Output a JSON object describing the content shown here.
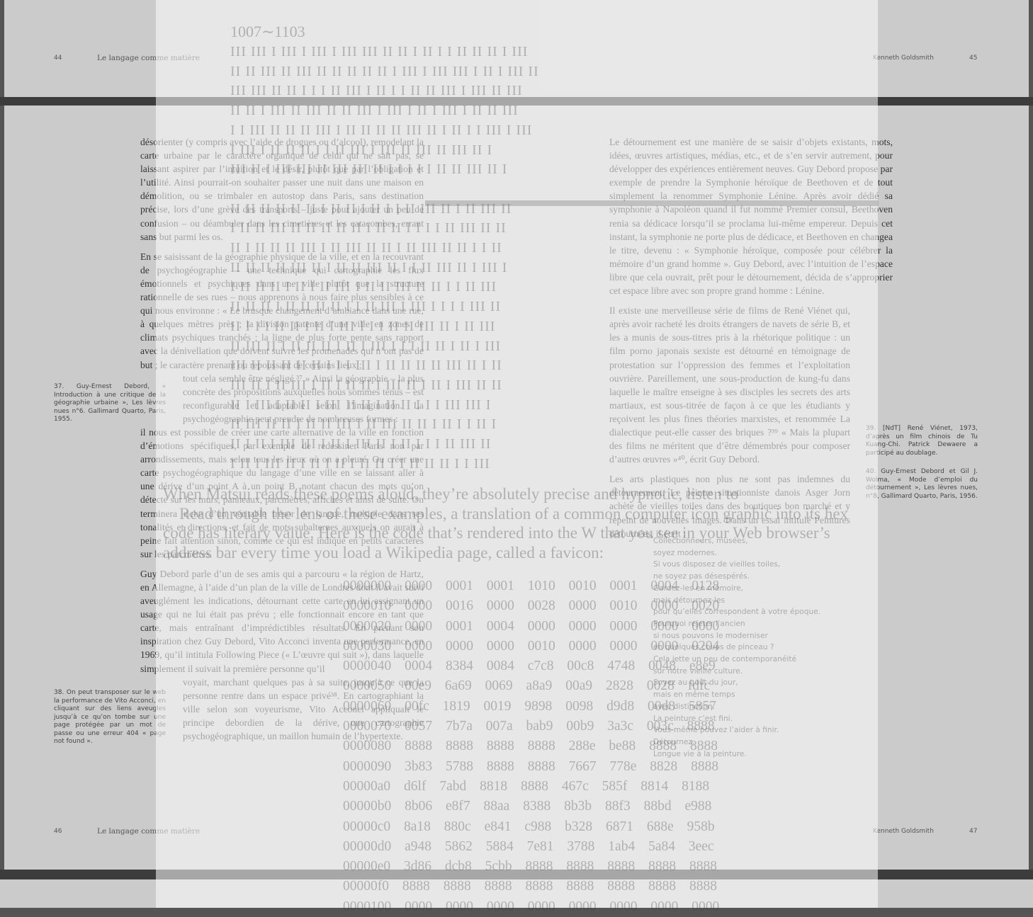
{
  "top_page": {
    "left_folio": "44",
    "left_title": "Le langage comme matière",
    "right_author": "Kenneth Goldsmith",
    "right_folio": "45"
  },
  "bottom_page": {
    "left_folio": "46",
    "left_title": "Le langage comme matière",
    "right_author": "Kenneth Goldsmith",
    "right_folio": "47"
  },
  "left_column": {
    "p1": "désorienter (y compris avec l’aide de drogues ou d’alcool), remodelant la carte urbaine par le caractère organique de celui qui ne sait pas, se laissant aspirer par l’intuition et le désir, plutôt que par l’obligation et l’utilité. Ainsi pourrait-on souhaiter passer une nuit dans une maison en démolition, ou se trimbaler en autostop dans Paris, sans destination précise, lors d’une grève des transports – juste pour ajouter un peu de confusion – ou déambuler dans les cimetières et les catacombes, errant sans but parmi les os.",
    "p2a": "En se saisissant de la géographie physique de la ville, et en la recouvrant de psychogéographie – une technique qui cartographie les flux émotionnels et psychiques dans une ville plutôt que la structure rationnelle de ses rues – nous apprenons à nous faire plus sensibles à ce qui nous environne : « Le brusque changement d’ambiance dans une rue, à quelques mètres près ; la division patente d’une ville en zones de climats psychiques tranchés ; la ligne de plus forte pente sans rapport avec la dénivellation que doivent suivre les promenades qui n’ont pas de but ; le caractère prenant ou repoussant de certains lieux ;",
    "p2b": "tout cela semble être négligé.³⁷ » Ainsi la géographie – la plus concrète des propositions auxquelles nous sommes tenus – est reconfigurable et adaptable selon l’imagination. La psychogéographie peut prendre de nombreuses formes :",
    "p2c": "il nous est possible de créer une carte alternative de la ville en fonction d’émotions spécifiques, par exemple de redessiner Paris non par arrondissements, mais selon tous les lieux où on a pleuré. Ou créer une carte psychogéographique du langage d’une ville en se laissant aller à une dérive d’un point A à un point B, notant chacun des mots qu’on détecte sur les murs, panneaux, parcmètres, affiches et ainsi de suite. On terminera riche d’un véritable trésor de langue, multiple dans ses tonalités et directions, et fait de mots subalternes auxquels on aurait à peine fait attention sinon, comme ce qui est indiqué en petits caractères sur les parcmètres.",
    "p3a": "Guy Debord parle d’un de ses amis qui a parcouru « la région de Hartz, en Allemagne, à l’aide d’un plan de la ville de Londres dont il avait suivi aveuglément les indications, détournant cette carte en lui assignant un usage qui ne lui était pas prévu ; elle fonctionnait encore en tant que carte, mais entraînant d’imprédictibles résultats. En prenant son inspiration chez Guy Debord, Vito Acconci inventa une performance, en 1969, qu’il intitula Following Piece (« L’œuvre qui suit »), dans laquelle simplement il suivait la première personne qu’il",
    "p3b": "voyait, marchant quelques pas à sa suite, jusqu’à ce que la personne rentre dans un espace privé³⁸. En cartographiant la ville selon son voyeurisme, Vito Acconci appliquait le principe debordien de la dérive, une cartographie psychogéographique, un maillon humain de l’hypertexte."
  },
  "right_column": {
    "p1": "Le détournement est une manière de se saisir d’objets existants, mots, idées, œuvres artistiques, médias, etc., et de s’en servir autrement, pour développer des expériences entièrement neuves. Guy Debord propose par exemple de prendre la Symphonie héroïque de Beethoven et de tout simplement la renommer Symphonie Lénine. Après avoir dédié sa symphonie à Napoléon quand il fut nommé Premier consul, Beethoven renia sa dédicace lorsqu’il se proclama lui-même empereur. Depuis cet instant, la symphonie ne porte plus de dédicace, et Beethoven en changea le titre, devenu : « Symphonie héroïque, composée pour célébrer la mémoire d’un grand homme ». Guy Debord, avec l’intuition de l’espace libre que cela ouvrait, prêt pour le détournement, décida de s’approprier cet espace libre avec son propre grand homme : Lénine.",
    "p2": "Il existe une merveilleuse série de films de René Viénet qui, après avoir racheté les droits étrangers de navets de série B, et les a munis de sous-titres pris à la rhétorique politique : un film porno japonais sexiste est détourné en témoignage de protestation sur l’oppression des femmes et l’exploitation ouvrière. Pareillement, une sous-production de kung-fu dans laquelle le maître enseigne à ses disciples les secrets des arts martiaux, est sous-titrée de façon à ce que les étudiants y reçoivent les plus fines théories marxistes, et renommée La dialectique peut-elle casser des briques ?³⁹ « Mais la plupart des films ne méritent que d’être démembrés pour composer d’autres œuvres »⁴⁰, écrit Guy Debord.",
    "p3": "Les arts plastiques non plus ne sont pas indemnes du détournement. Le peintre situationniste danois Asger Jorn achète de vieilles toiles dans des boutiques bon marché et y repeint de nouvelles images. Dans un essai intitulé Peintures détournées, il écrit :"
  },
  "poem": [
    "Collectionneurs, musées,",
    "soyez modernes.",
    "Si vous disposez de vieilles toiles,",
    "ne soyez pas désespérés.",
    "Gardez-les en mémoire,",
    "mais détournez-les",
    "pour qu’elles correspondent à votre époque.",
    "Pourquoi rejeter l’ancien",
    "si nous pouvons le moderniser",
    "en quelques coups de pinceau ?",
    "Cela jette un peu de contemporanéité",
    "sur notre vieille culture.",
    "Soyez au goût du jour,",
    "mais en même temps",
    "avec distinction.",
    "La peinture c’est fini.",
    "Vous-même pouvez l’aider à finir.",
    "Détournez.",
    "Longue vie à la peinture."
  ],
  "notes": {
    "n37": "37. Guy-Ernest Debord, « Introduction à une critique de la géographie urbaine », Les lèvres nues n°6. Gallimard Quarto, Paris, 1955.",
    "n38": "38. On peut transposer sur le web la performance de Vito Acconci, en cliquant sur des liens aveugles jusqu’à ce qu’on tombe sur une page protégée par un mot de passe ou une erreur 404 « page not found ».",
    "n39": "39. [NdT] René Viénet, 1973, d’après un film chinois de Tu Kuang-Chi. Patrick Dewaere a participé au doublage.",
    "n40": "40. Guy-Ernest Debord et Gil J. Wolma, « Mode d’emploi du détournement », Les lèvres nues, n°8, Gallimard Quarto, Paris, 1956."
  },
  "ghost": {
    "range": "1007∼1103",
    "bar_rows": [
      "III III I III I III I III III II II I II I I II II II I III",
      "II II III II III II II II II II I III I III III I II I III II",
      "III III II II I I I II III I II I I II II III I III II III",
      "II II I III II III II II III I III I II I III I II II III",
      "I I III II II II III I II II II II III II I II I I III I III",
      "I III I II II II I I II III I III II III II III II I",
      "III II I III III II III III II I I I I I II II III II I",
      "",
      "II II II II II II I II II I II I I II III II I II III II",
      "I II II III II II II II II I II II I I I I II III II II",
      "II I II II II III I II III II II I II III II II I I II",
      "II II II II III II I II II III II I I II III II I III I",
      "I II II II I II I II III I II II III II II I I II III",
      "II II II I II II II II I I II III I III I I I I III II",
      "II I I I II II I II I III I I I II II III II I II III",
      "II III II I II II II I II I III I I I II II I II I III",
      "III II II II II II I I I III I II II II II III II I II",
      "III II I II III I II I II II I III II I II I III II II",
      "II I III I II II I III II II I II II I I I III III I",
      "II III II II I II II III I II III II II I II I I II I",
      "II I II I III III I II I III II I II I I I II III II",
      "I II I III II I II I II I II II I I II II II I I III"
    ],
    "prose": [
      "When Matsui reads these poems aloud, they’re absolutely precise and hypnotic, listen to",
      "    Read through the lens of these examples, a translation of a common computer icon graphic into its hex",
      "code has literary value. Here is the code that’s rendered into the W that you see in your Web browser’s",
      "address bar every time you load a Wikipedia page, called a favicon:"
    ],
    "hex_rows": [
      "0000000 0000 0001 0001 1010 0010 0001 0004 0128",
      "0000010 0000 0016 0000 0028 0000 0010 0000 0020",
      "0000020 0000 0001 0004 0000 0000 0000 0000 0000",
      "0000030 0000 0000 0000 0010 0000 0000 0000 0204",
      "0000040 0004 8384 0084 c7c8 00c8 4748 0048 e8e9",
      "0000050 00e9 6a69 0069 a8a9 00a9 2828 0028 fdfc",
      "0000060 00fc 1819 0019 9898 0098 d9d8 00d8 5857",
      "0000070 0057 7b7a 007a bab9 00b9 3a3c 003c 8888",
      "0000080 8888 8888 8888 8888 288e be88 8888 8888",
      "0000090 3b83 5788 8888 8888 7667 778e 8828 8888",
      "00000a0 d6lf 7abd 8818 8888 467c 585f 8814 8188",
      "00000b0 8b06 e8f7 88aa 8388 8b3b 88f3 88bd e988",
      "00000c0 8a18 880c e841 c988 b328 6871 688e 958b",
      "00000d0 a948 5862 5884 7e81 3788 1ab4 5a84 3eec",
      "00000e0 3d86 dcb8 5cbb 8888 8888 8888 8888 8888",
      "00000f0 8888 8888 8888 8888 8888 8888 8888 8888",
      "0000100 0000 0000 0000 0000 0000 0000 0000 0000"
    ]
  }
}
